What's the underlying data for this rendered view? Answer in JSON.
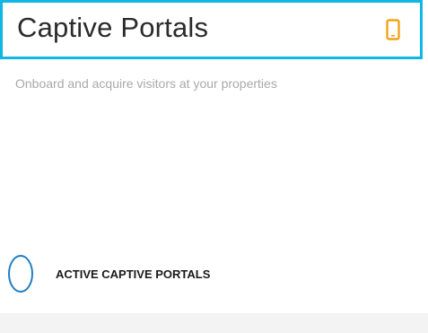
{
  "header": {
    "title": "Captive Portals",
    "icon": "mobile-phone-icon",
    "accent_color": "#0fb8e4",
    "icon_color": "#f2a31b"
  },
  "subtitle": "Onboard and acquire visitors at your properties",
  "stat": {
    "icon": "ring-icon",
    "ring_color": "#1f7fc4",
    "label": "ACTIVE CAPTIVE PORTALS"
  }
}
